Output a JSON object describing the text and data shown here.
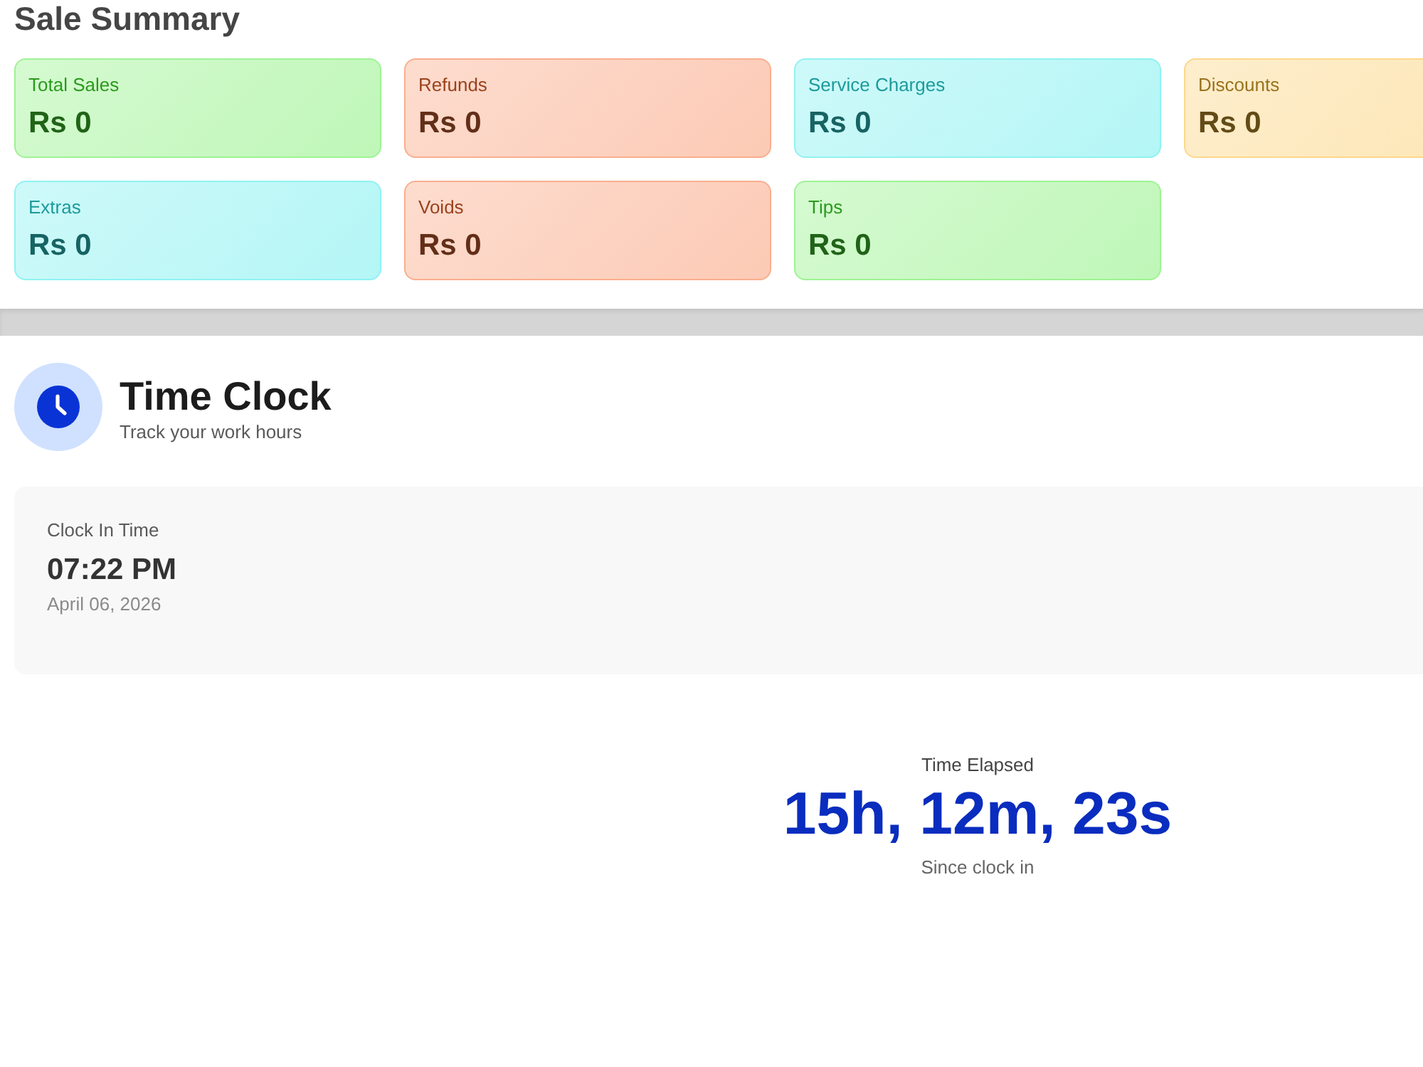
{
  "sale_summary": {
    "title": "Sale Summary",
    "cards": [
      {
        "label": "Total Sales",
        "value": "Rs 0",
        "color": "#bff7b8"
      },
      {
        "label": "Refunds",
        "value": "Rs 0",
        "color": "#fccab5"
      },
      {
        "label": "Service Charges",
        "value": "Rs 0",
        "color": "#b4f6f6"
      },
      {
        "label": "Discounts",
        "value": "Rs 0",
        "color": "#fde5b2"
      },
      {
        "label": "Extras",
        "value": "Rs 0",
        "color": "#b4f6f6"
      },
      {
        "label": "Voids",
        "value": "Rs 0",
        "color": "#fccab5"
      },
      {
        "label": "Tips",
        "value": "Rs 0",
        "color": "#bff7b8"
      }
    ]
  },
  "time_clock": {
    "title": "Time Clock",
    "subtitle": "Track your work hours",
    "clock_in": {
      "label": "Clock In Time",
      "time": "07:22 PM",
      "date": "April 06, 2026"
    },
    "elapsed": {
      "label": "Time Elapsed",
      "value": "15h, 12m, 23s",
      "note": "Since clock in"
    }
  }
}
